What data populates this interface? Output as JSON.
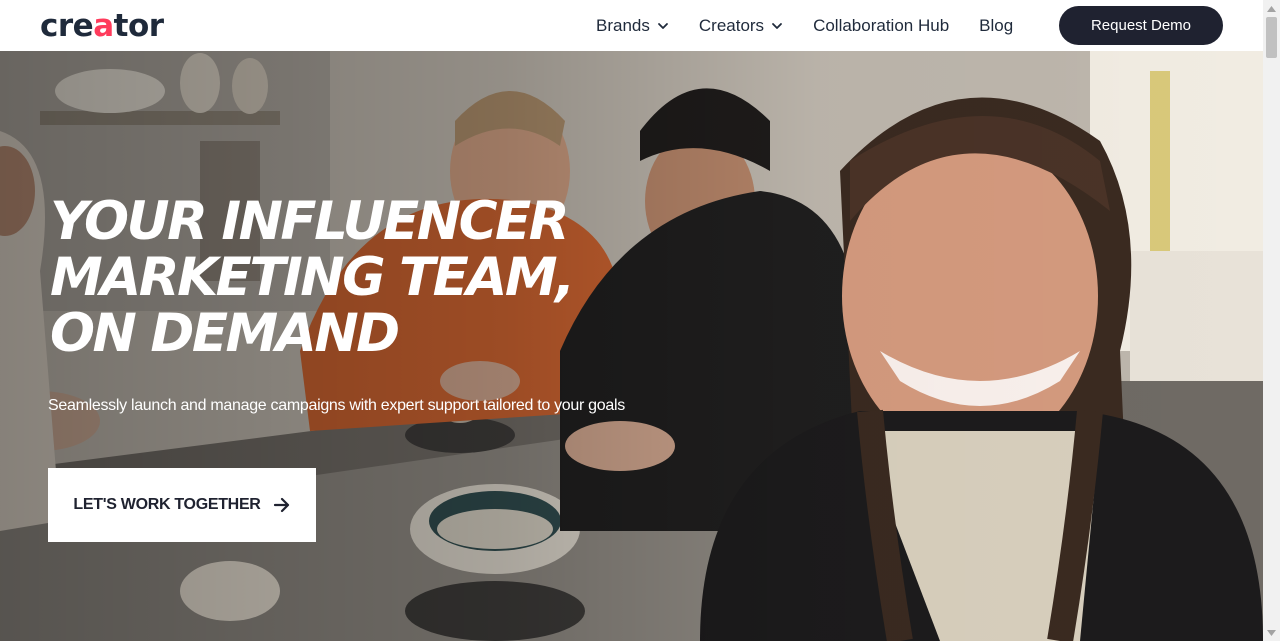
{
  "brand": {
    "logo_pre": "cre",
    "logo_accent": "a",
    "logo_post": "tor",
    "accent_color": "#ff3b5c",
    "text_color": "#1f2a3b"
  },
  "nav": {
    "items": [
      {
        "label": "Brands",
        "has_dropdown": true
      },
      {
        "label": "Creators",
        "has_dropdown": true
      },
      {
        "label": "Collaboration Hub",
        "has_dropdown": false
      },
      {
        "label": "Blog",
        "has_dropdown": false
      }
    ],
    "cta_label": "Request Demo",
    "cta_color": "#1f2230"
  },
  "hero": {
    "headline_lines": [
      "YOUR INFLUENCER",
      "MARKETING TEAM,",
      "ON DEMAND"
    ],
    "subtext": "Seamlessly launch and manage campaigns with expert support tailored to your goals",
    "cta_label": "LET'S WORK TOGETHER",
    "cta_icon": "arrow-right-icon",
    "background": "photo of smiling people at a pottery workshop table"
  }
}
